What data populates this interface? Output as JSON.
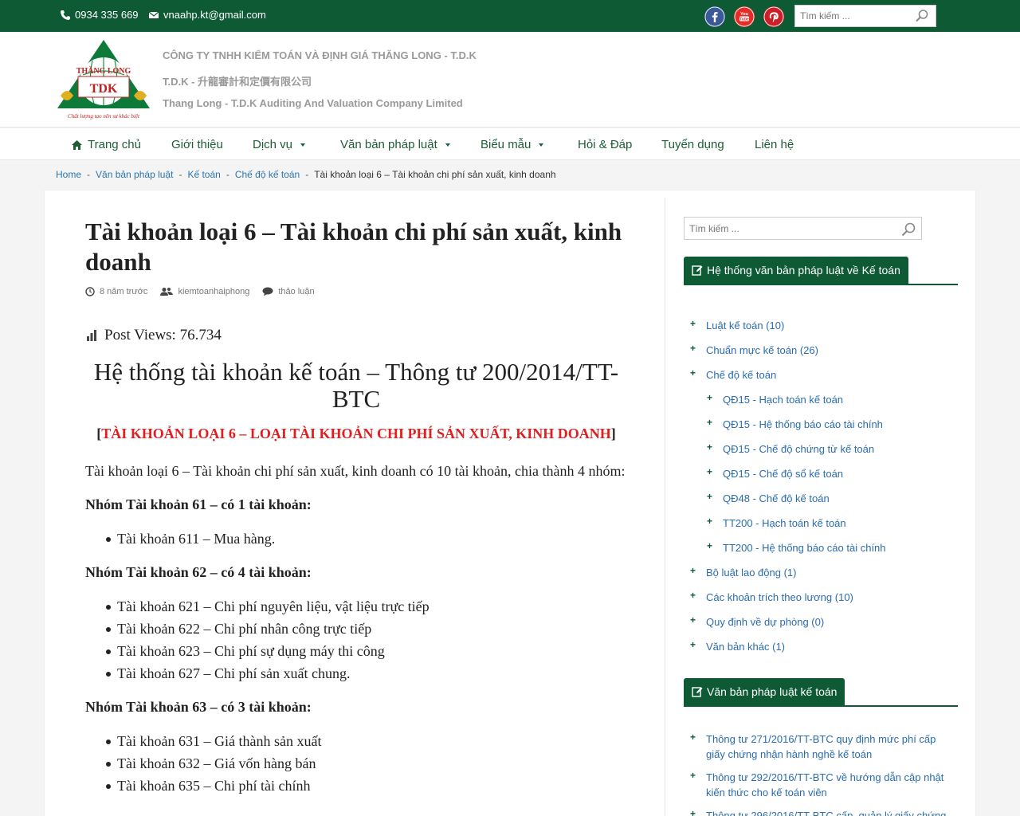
{
  "topbar": {
    "phone": "0934 335 669",
    "email": "vnaahp.kt@gmail.com",
    "search_placeholder": "Tìm kiếm ...",
    "social": {
      "facebook_color": "#3b5998",
      "youtube_color": "#e52d27",
      "pinterest_color": "#cb2027"
    }
  },
  "header": {
    "logo_text_top": "THĂNG LONG",
    "logo_text_mid": "TDK",
    "logo_text_bottom": "Chất lượng tạo nên sự khác biệt",
    "line1": "CÔNG TY TNHH KIỂM TOÁN VÀ ĐỊNH GIÁ THĂNG LONG - T.D.K",
    "line2": "T.D.K - 升龍審計和定價有限公司",
    "line3": "Thang Long - T.D.K Auditing And Valuation Company Limited"
  },
  "nav": [
    {
      "label": "Trang chủ"
    },
    {
      "label": "Giới thiệu"
    },
    {
      "label": "Dịch vụ"
    },
    {
      "label": "Văn bản pháp luật"
    },
    {
      "label": "Biểu mẫu"
    },
    {
      "label": "Hỏi & Đáp"
    },
    {
      "label": "Tuyển dụng"
    },
    {
      "label": "Liên hệ"
    }
  ],
  "breadcrumb": [
    "Home",
    "Văn bản pháp luật",
    "Kế toán",
    "Chế độ kế toán",
    "Tài khoản loại 6 – Tài khoản chi phí sản xuất, kinh doanh"
  ],
  "article": {
    "title": "Tài khoản loại 6 – Tài khoản chi phí sản xuất, kinh doanh",
    "meta_time": "8 năm trước",
    "meta_author": "kiemtoanhaiphong",
    "meta_comments": "thảo luận",
    "views": "Post Views: 76.734",
    "heading": "Hệ thống tài khoản kế toán – Thông tư 200/2014/TT-BTC",
    "sub_open": "[",
    "sub_red": "TÀI KHOẢN LOẠI 6 – LOẠI TÀI KHOẢN CHI PHÍ SẢN XUẤT, KINH DOANH",
    "sub_close": "]",
    "intro": "Tài khoản loại 6 – Tài khoản chi phí sản xuất, kinh doanh có 10 tài khoản, chia thành 4 nhóm:",
    "group1": "Nhóm Tài khoản 61 – có 1 tài khoản:",
    "group1_items": [
      "Tài khoản 611 – Mua hàng."
    ],
    "group2": "Nhóm Tài khoản 62 – có 4 tài khoản:",
    "group2_items": [
      "Tài khoản 621 – Chi phí nguyên liệu, vật liệu trực tiếp",
      "Tài khoản 622 – Chi phí nhân công trực tiếp",
      "Tài khoản 623 – Chi phí sự dụng máy thi công",
      "Tài khoản 627 – Chi phí sản xuất chung."
    ],
    "group3": "Nhóm Tài khoản 63 – có 3 tài khoản:",
    "group3_items": [
      "Tài khoản 631 – Giá thành sản xuất",
      "Tài khoản 632 – Giá vốn hàng bán",
      "Tài khoản 635 – Chi phí tài chính"
    ]
  },
  "sidebar": {
    "search_placeholder": "Tìm kiếm ...",
    "widget1_title": "Hệ thống văn bản pháp luật về Kế toán",
    "widget1_items": [
      {
        "label": "Luật kế toán (10)",
        "level": 0
      },
      {
        "label": "Chuẩn mực kế toán (26)",
        "level": 0
      },
      {
        "label": "Chế độ kế toán",
        "level": 0
      },
      {
        "label": "QĐ15 - Hạch toán kế toán",
        "level": 1
      },
      {
        "label": "QĐ15 - Hệ thống báo cáo tài chính",
        "level": 1
      },
      {
        "label": "QĐ15 - Chế độ chứng từ kế toán",
        "level": 1
      },
      {
        "label": "QĐ15 - Chế độ sổ kế toán",
        "level": 1
      },
      {
        "label": "QĐ48 - Chế độ kế toán",
        "level": 1
      },
      {
        "label": "TT200 - Hạch toán kế toán",
        "level": 1
      },
      {
        "label": "TT200 - Hệ thống báo cáo tài chính",
        "level": 1
      },
      {
        "label": "Bộ luật lao động (1)",
        "level": 0
      },
      {
        "label": "Các khoản trích theo lương (10)",
        "level": 0
      },
      {
        "label": "Quy định về dự phòng (0)",
        "level": 0
      },
      {
        "label": "Văn bản khác (1)",
        "level": 0
      }
    ],
    "widget2_title": "Văn bản pháp luật kế toán",
    "widget2_items": [
      "Thông tư 271/2016/TT-BTC quy định mức phí cấp giấy chứng nhận hành nghề kế toán",
      "Thông tư 292/2016/TT-BTC về hướng dẫn cập nhật kiến thức cho kế toán viên",
      "Thông tư 296/2016/TT-BTC cấp, quản lý giấy chứng"
    ]
  }
}
